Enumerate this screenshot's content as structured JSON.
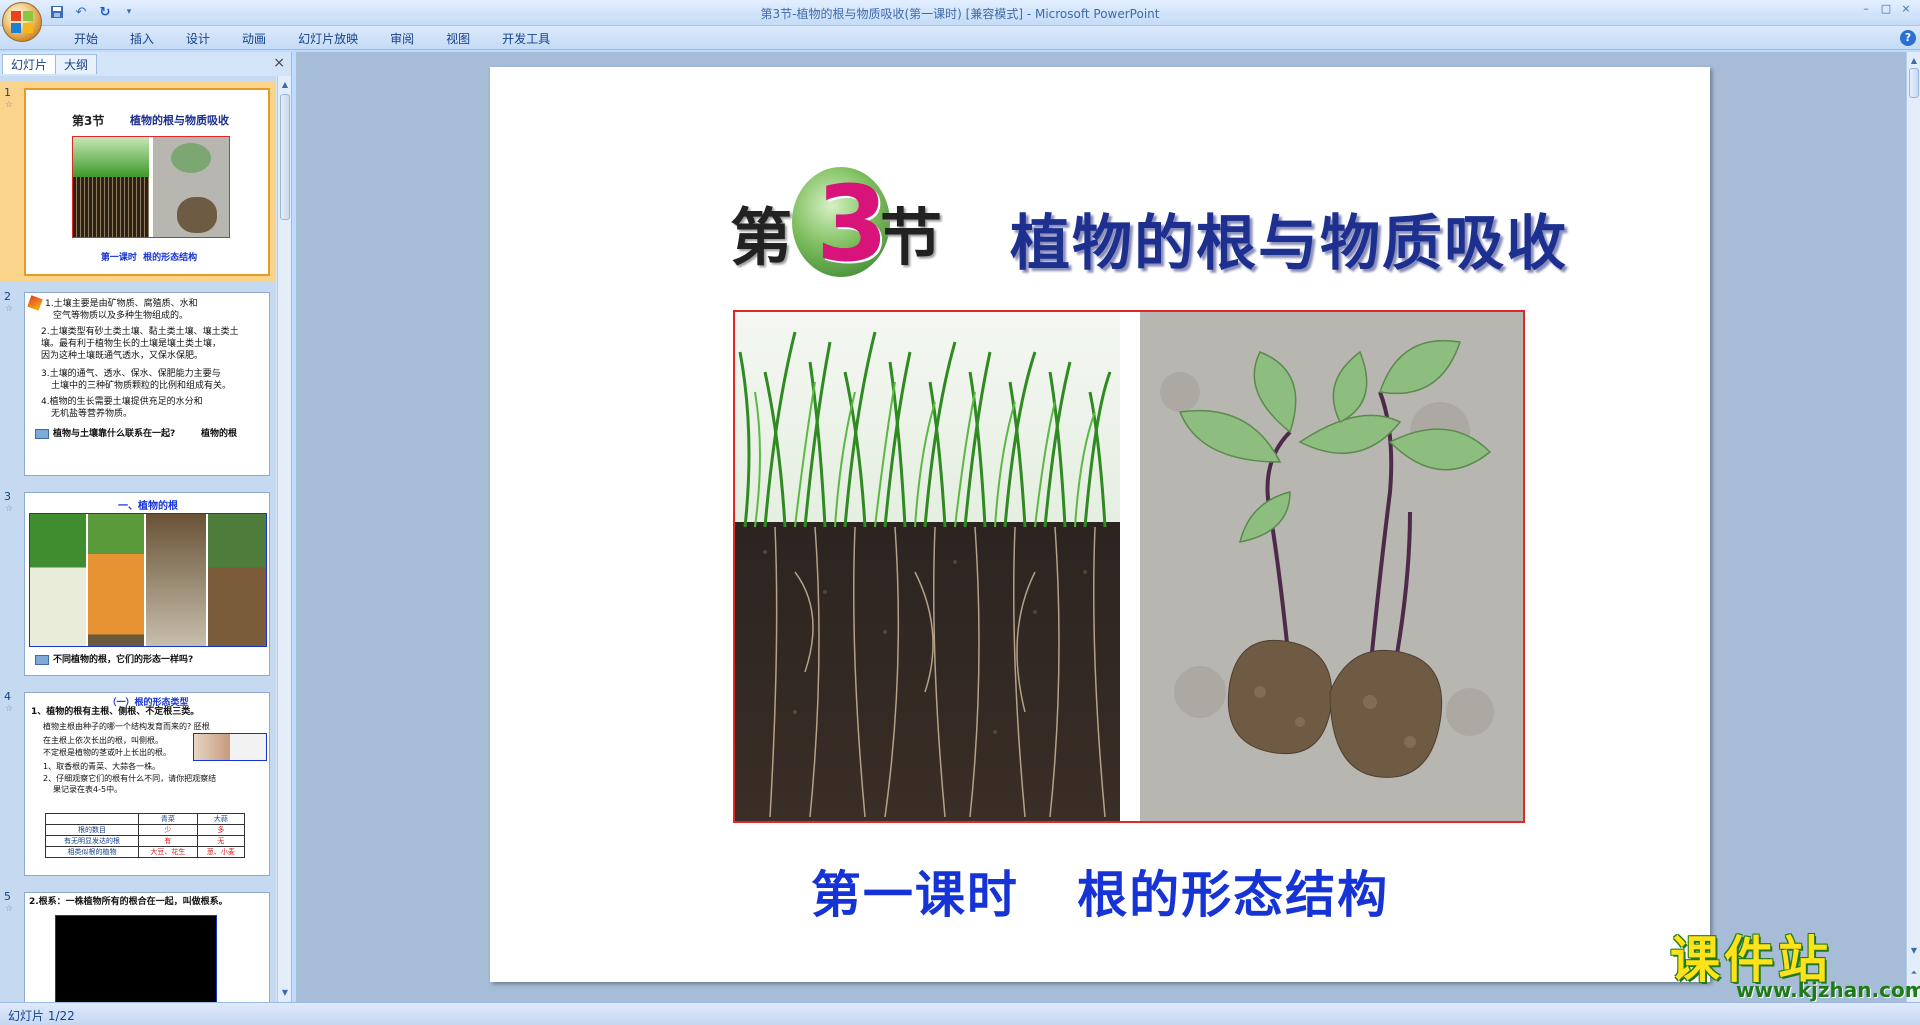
{
  "window": {
    "title": "第3节-植物的根与物质吸收(第一课时) [兼容模式] - Microsoft PowerPoint",
    "controls": [
      "–",
      "□",
      "×"
    ]
  },
  "quick_access": [
    "save-icon",
    "undo-icon",
    "redo-icon",
    "customize-icon"
  ],
  "ribbon": {
    "tabs": [
      "开始",
      "插入",
      "设计",
      "动画",
      "幻灯片放映",
      "审阅",
      "视图",
      "开发工具"
    ]
  },
  "left_pane": {
    "tabs": [
      "幻灯片",
      "大纲"
    ],
    "close": "×",
    "slides": [
      {
        "number": "1",
        "title_badge": "第3节",
        "title": "植物的根与物质吸收",
        "caption": "第一课时  根的形态结构"
      },
      {
        "number": "2",
        "lines": [
          "1.土壤主要是由矿物质、腐殖质、水和",
          "空气等物质以及多种生物组成的。",
          "2.土壤类型有砂土类土壤、黏土类土壤、壤土类土",
          "壤。最有利于植物生长的土壤是壤土类土壤，",
          "因为这种土壤既通气透水，又保水保肥。",
          "3.土壤的通气、透水、保水、保肥能力主要与",
          "土壤中的三种矿物质颗粒的比例和组成有关。",
          "4.植物的生长需要土壤提供充足的水分和",
          "无机盐等营养物质。"
        ],
        "question": "植物与土壤靠什么联系在一起?",
        "answer": "植物的根"
      },
      {
        "number": "3",
        "heading": "一、植物的根",
        "question": "不同植物的根，它们的形态一样吗?"
      },
      {
        "number": "4",
        "heading": "（一）根的形态类型",
        "line1": "1、植物的根有主根、侧根、不定根三类。",
        "line2": "植物主根由种子的哪一个结构发育而来的?  胚根",
        "line3": "在主根上依次长出的根，叫侧根。",
        "line4": "不定根是植物的茎或叶上长出的根。",
        "line5": "1、取香根的青菜、大蒜各一株。",
        "line6": "2、仔细观察它们的根有什么不同，请你把观察结",
        "line7": "果记录在表4-5中。",
        "table": {
          "headers": [
            "",
            "青菜",
            "大蒜"
          ],
          "rows": [
            [
              "根的数目",
              "少",
              "多"
            ],
            [
              "有无明显发达的根",
              "有",
              "无"
            ],
            [
              "相类似根的植物",
              "大豆、花生",
              "葱、小麦"
            ]
          ]
        }
      },
      {
        "number": "5",
        "line": "2.根系：一株植物所有的根合在一起，叫做根系。"
      }
    ]
  },
  "slide": {
    "badge_prefix": "第",
    "badge_number": "3",
    "badge_suffix": "节",
    "title": "植物的根与物质吸收",
    "subtitle": "第一课时   根的形态结构"
  },
  "watermark": {
    "text": "课件站",
    "url": "www.kjzhan.com"
  },
  "statusbar": {
    "text": "幻灯片 1/22"
  },
  "colors": {
    "title_blue": "#1d2f8f",
    "subtitle_blue": "#1633d6",
    "badge_pink": "#d8147a",
    "frame_red": "#e02828",
    "watermark_yellow": "#ffe21a"
  }
}
